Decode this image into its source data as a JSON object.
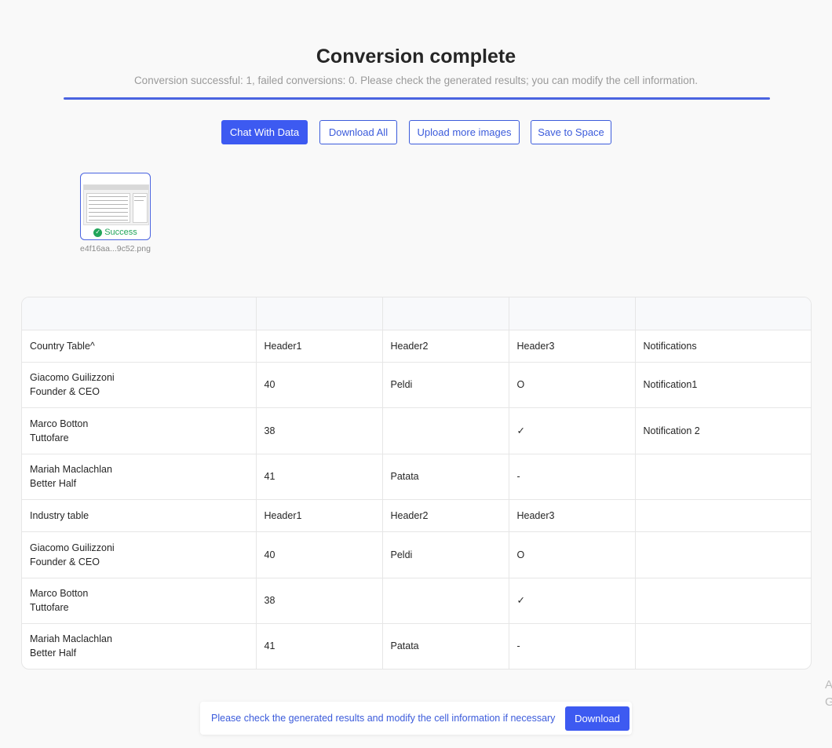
{
  "header": {
    "title": "Conversion complete",
    "subtitle": "Conversion successful: 1, failed conversions: 0. Please check the generated results; you can modify the cell information."
  },
  "progress": {
    "percent": 100,
    "color": "#4a63e0"
  },
  "toolbar": {
    "chat_label": "Chat With Data",
    "download_all_label": "Download All",
    "upload_label": "Upload more images",
    "save_label": "Save to Space"
  },
  "files": [
    {
      "name": "e4f16aa...9c52.png",
      "status": "Success",
      "status_icon": "check-circle-icon"
    }
  ],
  "table": {
    "rows": [
      {
        "type": "head",
        "cells": [
          [
            ""
          ],
          [
            ""
          ],
          [
            ""
          ],
          [
            ""
          ],
          [
            ""
          ]
        ]
      },
      {
        "cells": [
          [
            "Country Table^"
          ],
          [
            "Header1"
          ],
          [
            "Header2"
          ],
          [
            "Header3"
          ],
          [
            "Notifications"
          ]
        ]
      },
      {
        "cells": [
          [
            "Giacomo Guilizzoni",
            "Founder & CEO"
          ],
          [
            "40"
          ],
          [
            "Peldi"
          ],
          [
            "O"
          ],
          [
            "Notification1"
          ]
        ]
      },
      {
        "cells": [
          [
            "Marco Botton",
            "Tuttofare"
          ],
          [
            "38"
          ],
          [
            ""
          ],
          [
            "✓"
          ],
          [
            "Notification 2"
          ]
        ]
      },
      {
        "cells": [
          [
            "Mariah Maclachlan",
            "Better Half"
          ],
          [
            "41"
          ],
          [
            "Patata"
          ],
          [
            "-"
          ],
          [
            ""
          ]
        ]
      },
      {
        "cells": [
          [
            "Industry table"
          ],
          [
            "Header1"
          ],
          [
            "Header2"
          ],
          [
            "Header3"
          ],
          [
            ""
          ]
        ]
      },
      {
        "cells": [
          [
            "Giacomo Guilizzoni",
            "Founder & CEO"
          ],
          [
            "40"
          ],
          [
            "Peldi"
          ],
          [
            "O"
          ],
          [
            ""
          ]
        ]
      },
      {
        "cells": [
          [
            "Marco Botton",
            "Tuttofare"
          ],
          [
            "38"
          ],
          [
            ""
          ],
          [
            "✓"
          ],
          [
            ""
          ]
        ]
      },
      {
        "cells": [
          [
            "Mariah Maclachlan",
            "Better Half"
          ],
          [
            "41"
          ],
          [
            "Patata"
          ],
          [
            "-"
          ],
          [
            ""
          ]
        ]
      }
    ]
  },
  "footer": {
    "message": "Please check the generated results and modify the cell information if necessary",
    "download_label": "Download"
  },
  "edge_text": [
    "A",
    "G"
  ],
  "colors": {
    "accent": "#3d5af1",
    "success": "#22a55a"
  }
}
